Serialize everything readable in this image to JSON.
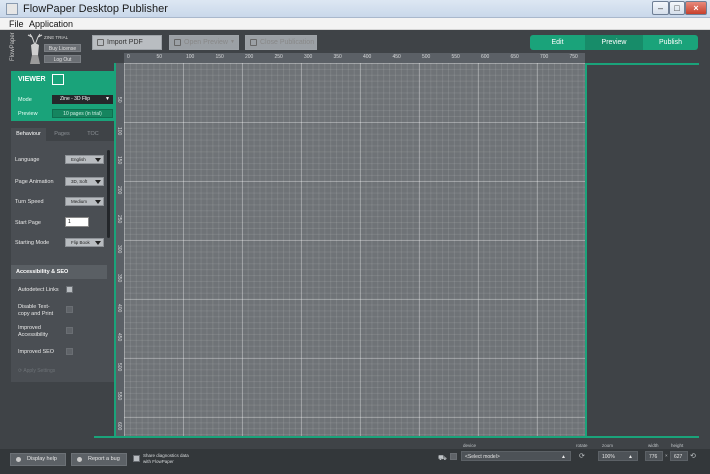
{
  "window": {
    "title": "FlowPaper Desktop Publisher"
  },
  "menu": {
    "file": "File",
    "application": "Application"
  },
  "logo": {
    "brand": "FlowPaper",
    "edition": "ZINE TRIAL",
    "buy": "Buy License",
    "logout": "Log Out"
  },
  "toolbar": {
    "import_pdf": "Import PDF",
    "open_preview": "Open Preview",
    "close_publication": "Close Publication"
  },
  "modes": {
    "edit": "Edit",
    "preview": "Preview",
    "publish": "Publish",
    "active_color": "#1aa37a",
    "selected_color": "#16b58a"
  },
  "viewer": {
    "title": "VIEWER",
    "mode_label": "Mode",
    "mode_value": "Zine - 3D Flip",
    "preview_label": "Preview",
    "preview_value": "10 pages (in trial)"
  },
  "tabs": [
    "Behaviour",
    "Pages",
    "TOC"
  ],
  "behaviour": {
    "language_label": "Language",
    "language_value": "English",
    "page_animation_label": "Page Animation",
    "page_animation_value": "3D, Soft",
    "turn_speed_label": "Turn Speed",
    "turn_speed_value": "Medium",
    "start_page_label": "Start Page",
    "start_page_value": "1",
    "starting_mode_label": "Starting Mode",
    "starting_mode_value": "Flip Book"
  },
  "accessibility": {
    "heading": "Accessibility & SEO",
    "autodetect_links": "Autodetect Links",
    "disable_text_1": "Disable Text-",
    "disable_text_2": "copy and Print",
    "improved_acc_1": "Improved",
    "improved_acc_2": "Accessibility",
    "improved_seo": "Improved SEO",
    "apply": "Apply Settings"
  },
  "ruler_top": [
    "0",
    "50",
    "100",
    "150",
    "200",
    "250",
    "300",
    "350",
    "400",
    "450",
    "500",
    "550",
    "600",
    "650",
    "700",
    "750"
  ],
  "ruler_left": [
    "50",
    "100",
    "150",
    "200",
    "250",
    "300",
    "350",
    "400",
    "450",
    "500",
    "550",
    "600"
  ],
  "status": {
    "display_help": "Display help",
    "report_bug": "Report a bug",
    "share_1": "Share diagnostics data",
    "share_2": "with FlowPaper",
    "device_label": "device",
    "device_value": "<Select model>",
    "rotate_label": "rotate",
    "zoom_label": "zoom",
    "zoom_value": "100%",
    "width_label": "width",
    "width_value": "776",
    "height_label": "height",
    "height_value": "627"
  }
}
